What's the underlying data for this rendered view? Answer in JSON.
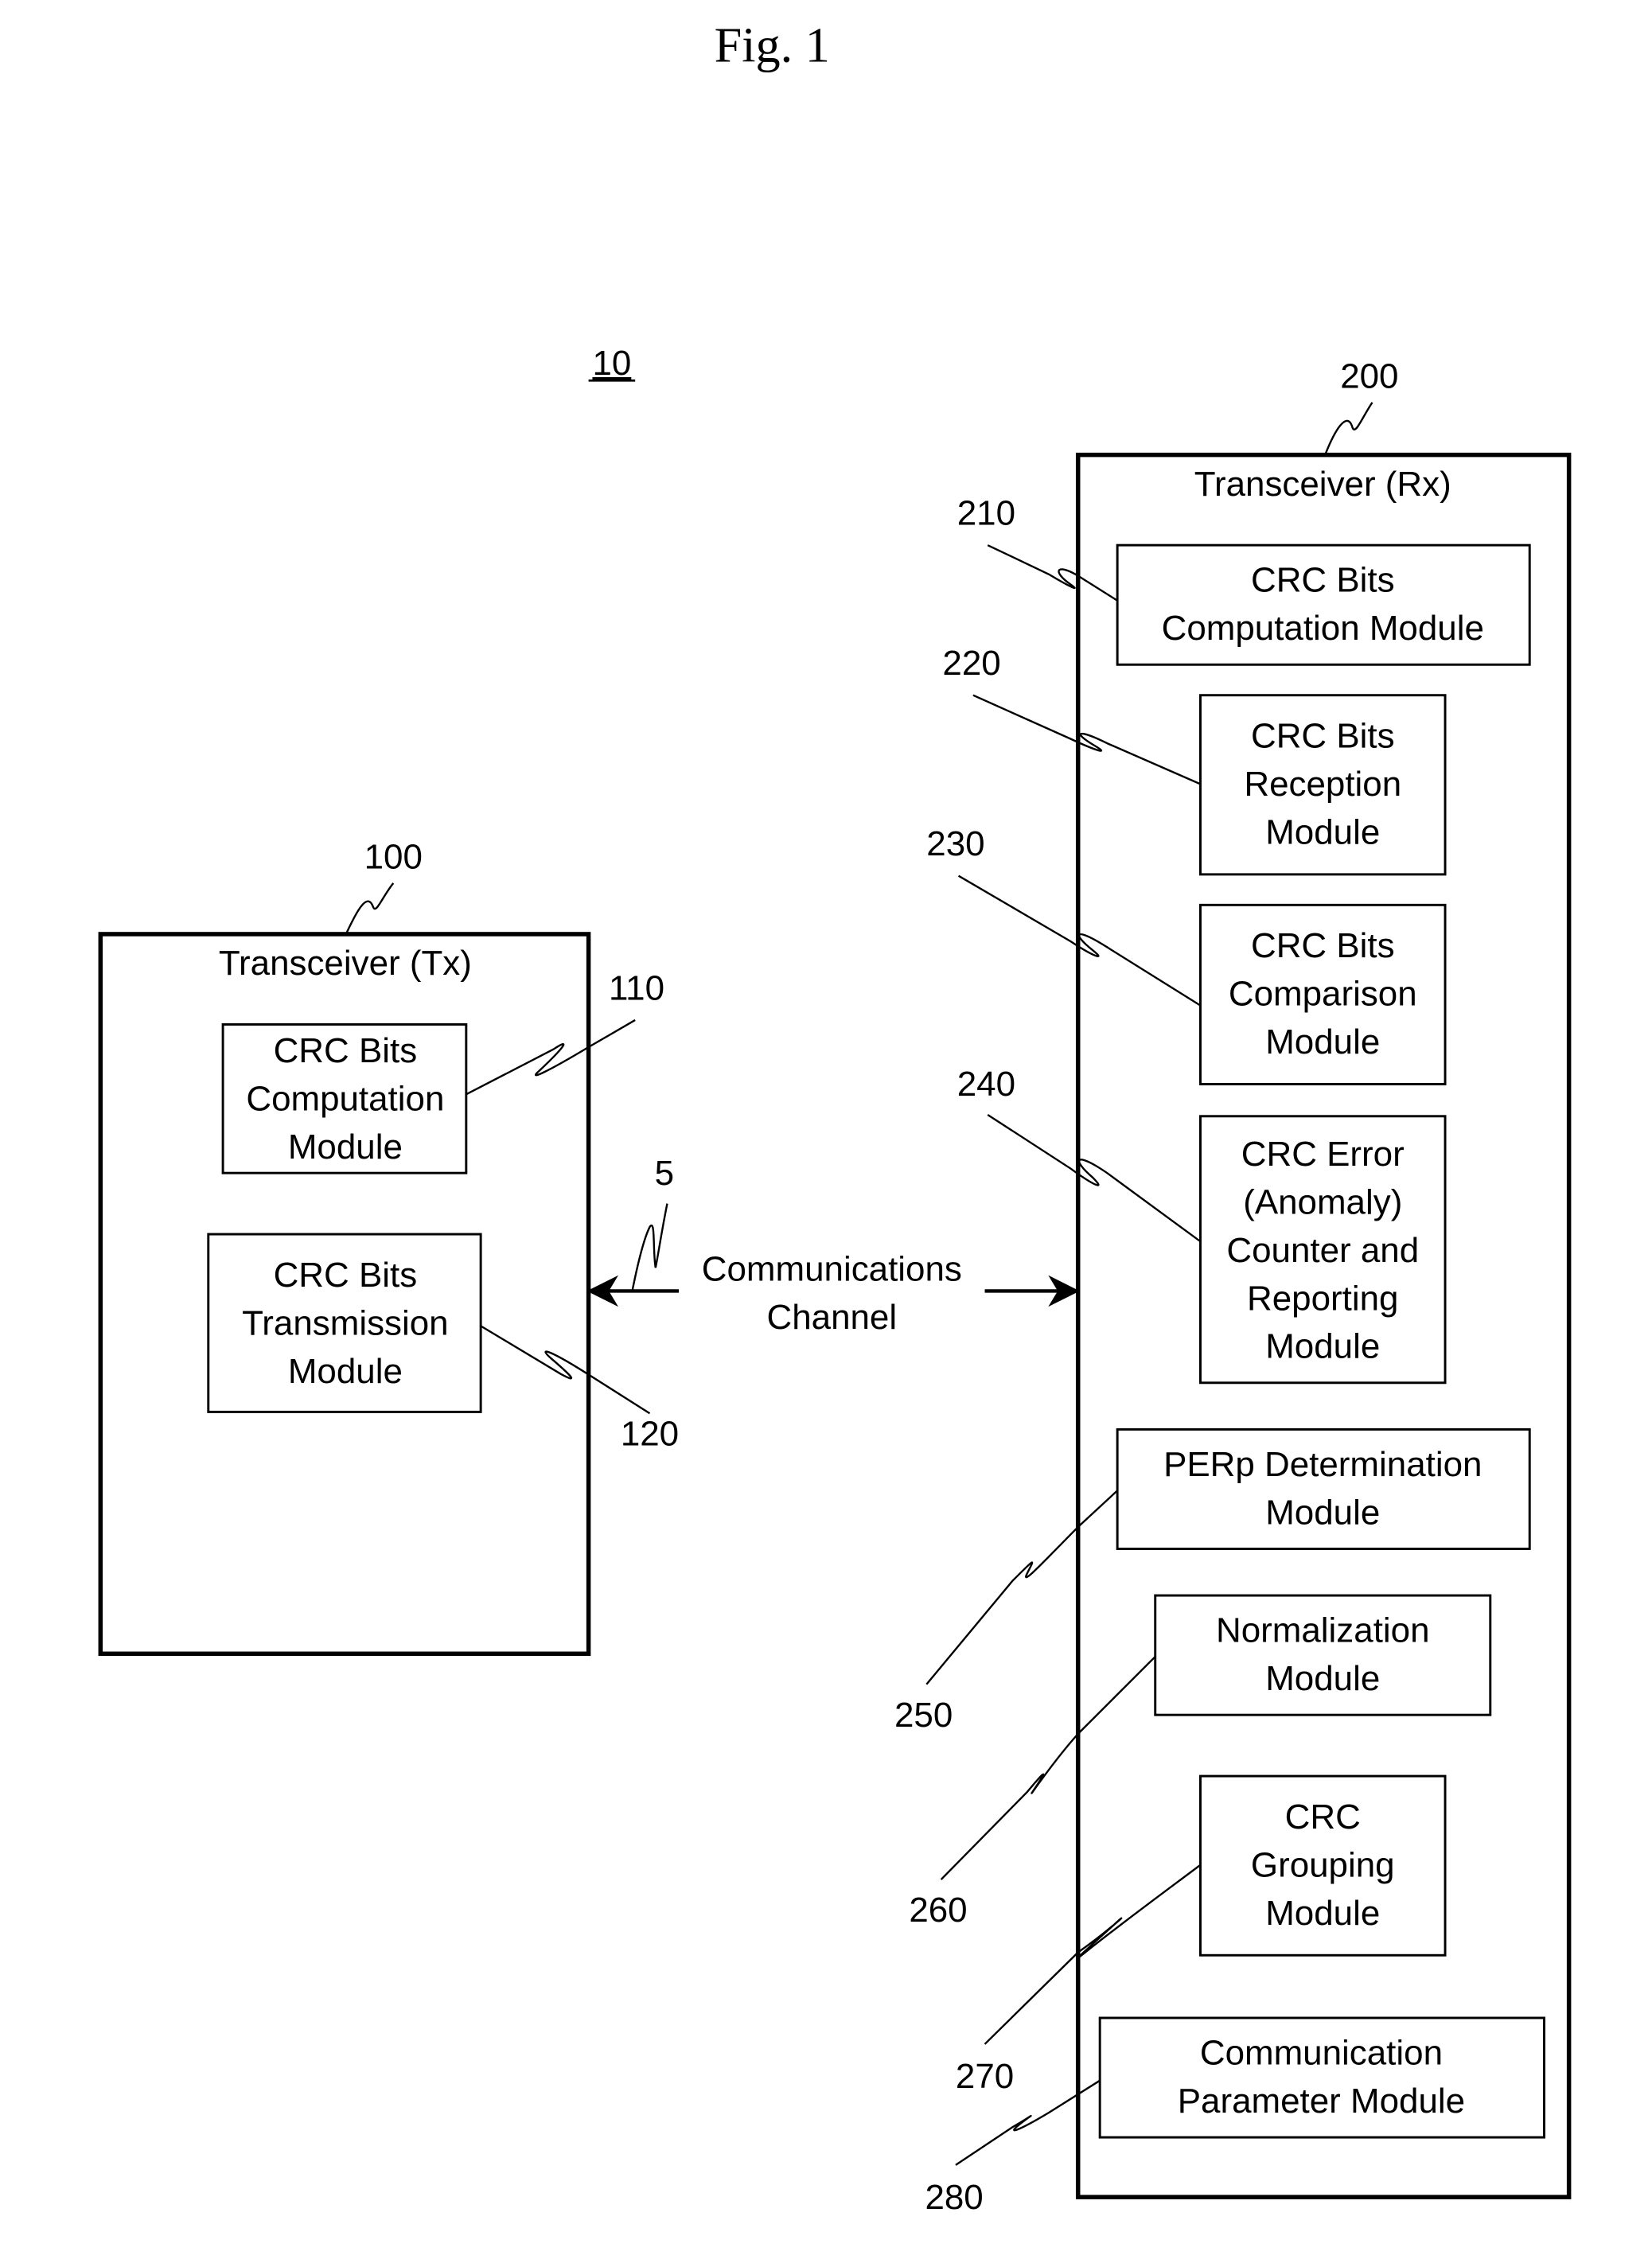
{
  "figure": {
    "title": "Fig. 1",
    "system_ref": "10"
  },
  "tx": {
    "ref": "100",
    "title": "Transceiver (Tx)",
    "modules": [
      {
        "ref": "110",
        "lines": [
          "CRC Bits",
          "Computation",
          "Module"
        ]
      },
      {
        "ref": "120",
        "lines": [
          "CRC Bits",
          "Transmission",
          "Module"
        ]
      }
    ]
  },
  "channel": {
    "ref": "5",
    "lines": [
      "Communications",
      "Channel"
    ]
  },
  "rx": {
    "ref": "200",
    "title": "Transceiver (Rx)",
    "modules": [
      {
        "ref": "210",
        "lines": [
          "CRC Bits",
          "Computation Module"
        ]
      },
      {
        "ref": "220",
        "lines": [
          "CRC Bits",
          "Reception",
          "Module"
        ]
      },
      {
        "ref": "230",
        "lines": [
          "CRC Bits",
          "Comparison",
          "Module"
        ]
      },
      {
        "ref": "240",
        "lines": [
          "CRC Error",
          "(Anomaly)",
          "Counter and",
          "Reporting",
          "Module"
        ]
      },
      {
        "ref": "250",
        "lines": [
          "PERp Determination",
          "Module"
        ]
      },
      {
        "ref": "260",
        "lines": [
          "Normalization",
          "Module"
        ]
      },
      {
        "ref": "270",
        "lines": [
          "CRC",
          "Grouping",
          "Module"
        ]
      },
      {
        "ref": "280",
        "lines": [
          "Communication",
          "Parameter Module"
        ]
      }
    ]
  }
}
